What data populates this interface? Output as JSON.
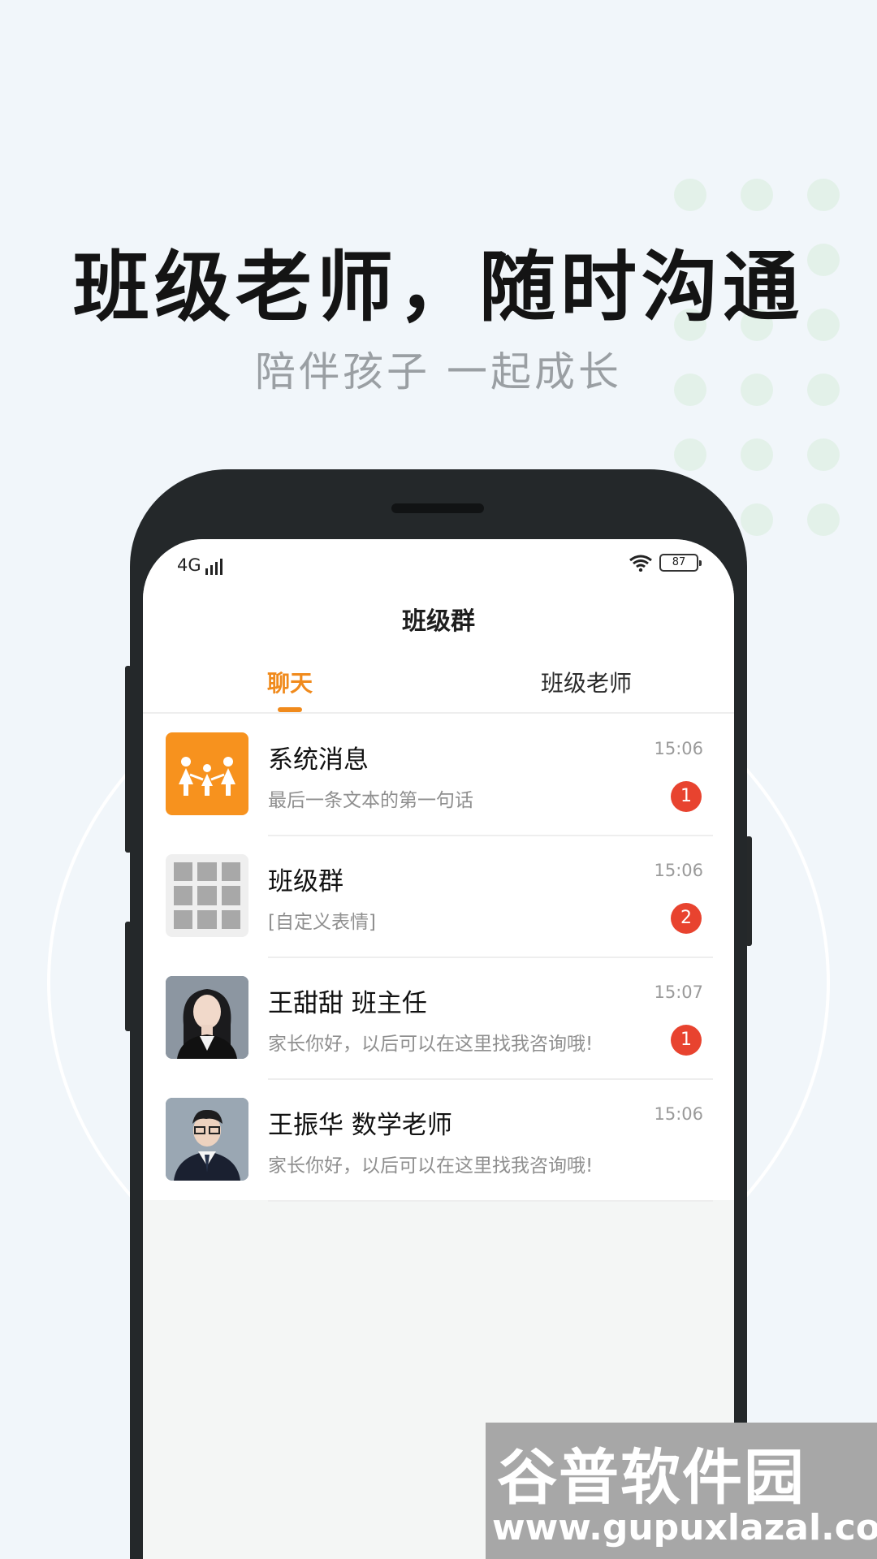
{
  "promo": {
    "headline": "班级老师，随时沟通",
    "subheadline": "陪伴孩子 一起成长"
  },
  "status_bar": {
    "network": "4G",
    "battery": "87",
    "icons": [
      "signal-bars-icon",
      "wifi-icon",
      "battery-icon"
    ]
  },
  "app": {
    "title": "班级群",
    "tabs": [
      {
        "label": "聊天",
        "active": true
      },
      {
        "label": "班级老师",
        "active": false
      }
    ],
    "accent_color": "#f08a1c",
    "badge_color": "#e8432f"
  },
  "chats": [
    {
      "name": "系统消息",
      "preview": "最后一条文本的第一句话",
      "time": "15:06",
      "unread": "1",
      "avatar": "family-icon"
    },
    {
      "name": "班级群",
      "preview": "[自定义表情]",
      "time": "15:06",
      "unread": "2",
      "avatar": "group-grid-icon"
    },
    {
      "name": "王甜甜 班主任",
      "preview": "家长你好，以后可以在这里找我咨询哦!",
      "time": "15:07",
      "unread": "1",
      "avatar": "teacher-photo-female"
    },
    {
      "name": "王振华 数学老师",
      "preview": "家长你好，以后可以在这里找我咨询哦!",
      "time": "15:06",
      "unread": "",
      "avatar": "teacher-photo-male"
    }
  ],
  "watermark": {
    "line1": "谷普软件园",
    "line2": "www.gupuxlazal.com"
  }
}
